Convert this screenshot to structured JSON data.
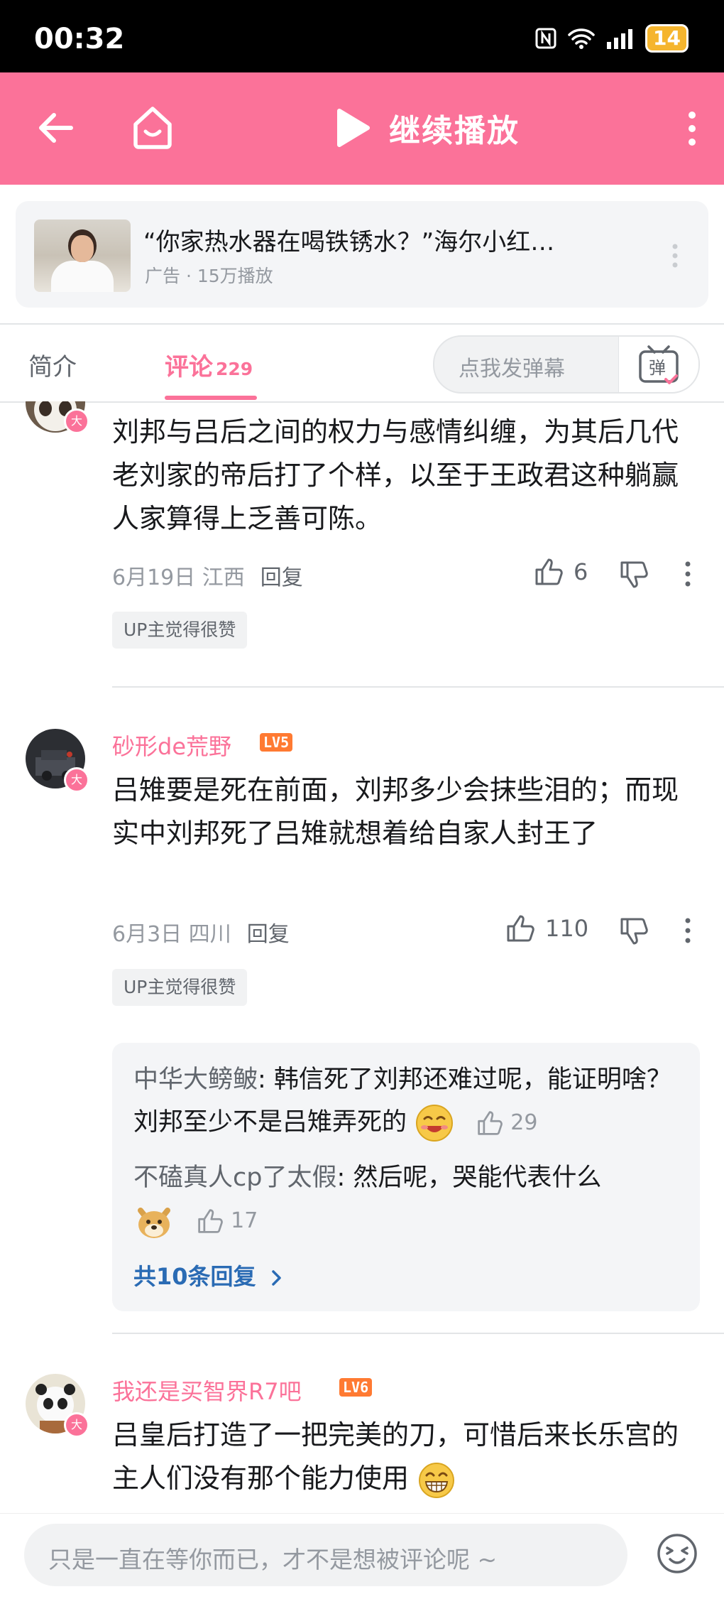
{
  "status_bar": {
    "time": "00:32",
    "battery": "14"
  },
  "header": {
    "play_label": "继续播放"
  },
  "ad": {
    "title": "“你家热水器在喝铁锈水？”海尔小红…",
    "meta": "广告 · 15万播放"
  },
  "tabs": {
    "intro": "简介",
    "comment": "评论",
    "comment_count": "229",
    "danmaku_placeholder": "点我发弹幕",
    "danmaku_icon_text": "弹"
  },
  "comments": [
    {
      "badge": "大",
      "content": "刘邦与吕后之间的权力与感情纠缠，为其后几代老刘家的帝后打了个样，以至于王政君这种躺赢人家算得上乏善可陈。",
      "date": "6月19日 江西",
      "reply": "回复",
      "likes": "6",
      "up_tag": "UP主觉得很赞"
    },
    {
      "badge": "大",
      "username": "砂形de荒野",
      "level": "LV5",
      "content": "吕雉要是死在前面，刘邦多少会抹些泪的；而现实中刘邦死了吕雉就想着给自家人封王了",
      "date": "6月3日 四川",
      "reply": "回复",
      "likes": "110",
      "up_tag": "UP主觉得很赞",
      "replies": [
        {
          "name": "中华大鳑鲏",
          "text": ": 韩信死了刘邦还难过呢，能证明啥？刘邦至少不是吕雉弄死的",
          "likes": "29"
        },
        {
          "name": "不磕真人cp了太假",
          "text": ": 然后呢，哭能代表什么",
          "likes": "17"
        }
      ],
      "more_replies": "共10条回复"
    },
    {
      "badge": "大",
      "username": "我还是买智界R7吧",
      "level": "LV6",
      "content": "吕皇后打造了一把完美的刀，可惜后来长乐宫的主人们没有那个能力使用"
    }
  ],
  "bottom": {
    "placeholder": "只是一直在等你而已，才不是想被评论呢 ~"
  },
  "colors": {
    "brand_pink": "#fb7299",
    "level_orange": "#ff7a32",
    "link_blue": "#2a6bb4"
  }
}
